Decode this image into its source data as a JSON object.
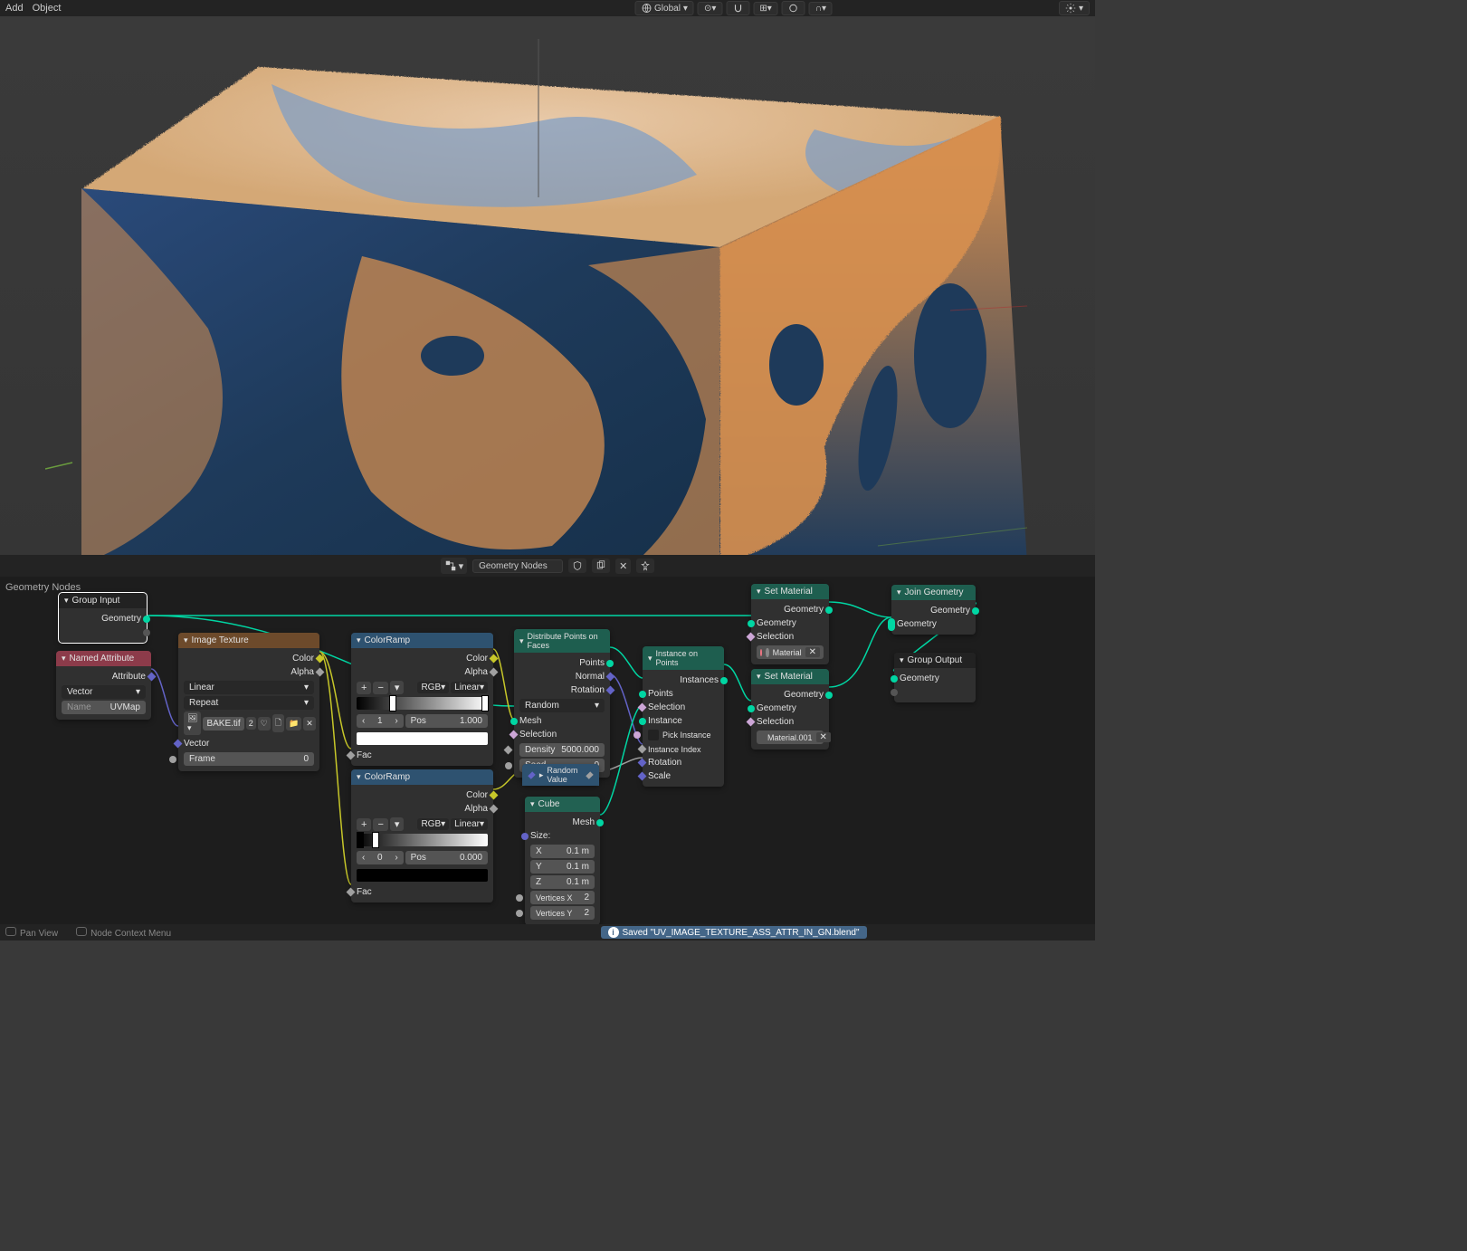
{
  "header": {
    "menu_add": "Add",
    "menu_object": "Object",
    "orientation": "Global"
  },
  "node_bar": {
    "title": "Geometry Nodes"
  },
  "editor": {
    "label": "Geometry Nodes"
  },
  "nodes": {
    "group_input": {
      "title": "Group Input",
      "out_geometry": "Geometry"
    },
    "named_attr": {
      "title": "Named Attribute",
      "out_attribute": "Attribute",
      "type": "Vector",
      "name_label": "Name",
      "name_value": "UVMap"
    },
    "img_tex": {
      "title": "Image Texture",
      "out_color": "Color",
      "out_alpha": "Alpha",
      "interp": "Linear",
      "extension": "Repeat",
      "image": "BAKE.tif",
      "users": "2",
      "in_vector": "Vector",
      "frame_label": "Frame",
      "frame_value": "0"
    },
    "ramp1": {
      "title": "ColorRamp",
      "out_color": "Color",
      "out_alpha": "Alpha",
      "mode": "RGB",
      "interp": "Linear",
      "idx": "1",
      "pos_label": "Pos",
      "pos_value": "1.000",
      "in_fac": "Fac"
    },
    "ramp2": {
      "title": "ColorRamp",
      "out_color": "Color",
      "out_alpha": "Alpha",
      "mode": "RGB",
      "interp": "Linear",
      "idx": "0",
      "pos_label": "Pos",
      "pos_value": "0.000",
      "in_fac": "Fac"
    },
    "dist": {
      "title": "Distribute Points on Faces",
      "out_points": "Points",
      "out_normal": "Normal",
      "out_rotation": "Rotation",
      "method": "Random",
      "in_mesh": "Mesh",
      "in_selection": "Selection",
      "density_label": "Density",
      "density_value": "5000.000",
      "seed_label": "Seed",
      "seed_value": "0"
    },
    "random": {
      "title": "Random Value"
    },
    "cube": {
      "title": "Cube",
      "out_mesh": "Mesh",
      "size_label": "Size:",
      "x_label": "X",
      "x_value": "0.1 m",
      "y_label": "Y",
      "y_value": "0.1 m",
      "z_label": "Z",
      "z_value": "0.1 m",
      "vx_label": "Vertices X",
      "vx_value": "2",
      "vy_label": "Vertices Y",
      "vy_value": "2"
    },
    "inst": {
      "title": "Instance on Points",
      "out_instances": "Instances",
      "in_points": "Points",
      "in_selection": "Selection",
      "in_instance": "Instance",
      "pick_instance": "Pick Instance",
      "in_instance_index": "Instance Index",
      "in_rotation": "Rotation",
      "in_scale": "Scale"
    },
    "setmat1": {
      "title": "Set Material",
      "out_geometry": "Geometry",
      "in_geometry": "Geometry",
      "in_selection": "Selection",
      "material": "Material"
    },
    "setmat2": {
      "title": "Set Material",
      "out_geometry": "Geometry",
      "in_geometry": "Geometry",
      "in_selection": "Selection",
      "material": "Material.001"
    },
    "join": {
      "title": "Join Geometry",
      "out_geometry": "Geometry",
      "in_geometry": "Geometry"
    },
    "group_output": {
      "title": "Group Output",
      "in_geometry": "Geometry"
    }
  },
  "status": {
    "pan": "Pan View",
    "ctx": "Node Context Menu",
    "saved": "Saved \"UV_IMAGE_TEXTURE_ASS_ATTR_IN_GN.blend\""
  }
}
